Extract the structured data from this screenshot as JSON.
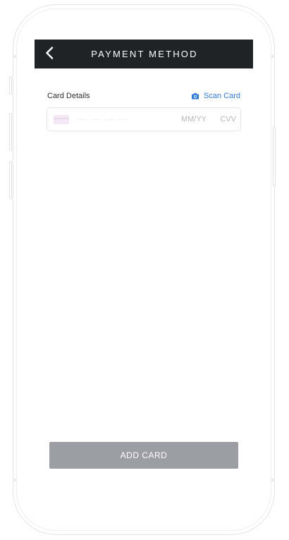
{
  "header": {
    "title": "PAYMENT METHOD",
    "back_icon": "chevron-left-icon"
  },
  "card_details": {
    "label": "Card Details",
    "scan_card_label": "Scan Card",
    "scan_icon": "camera-icon",
    "accent_color": "#2f7ad8"
  },
  "card_input": {
    "card_icon": "credit-card-icon",
    "card_number_placeholder": "···· ···· ···· ····",
    "expiry_placeholder": "MM/YY",
    "cvv_placeholder": "CVV"
  },
  "footer": {
    "add_card_label": "ADD CARD",
    "button_color": "#9d9da5"
  },
  "colors": {
    "header_bg": "#202326"
  }
}
